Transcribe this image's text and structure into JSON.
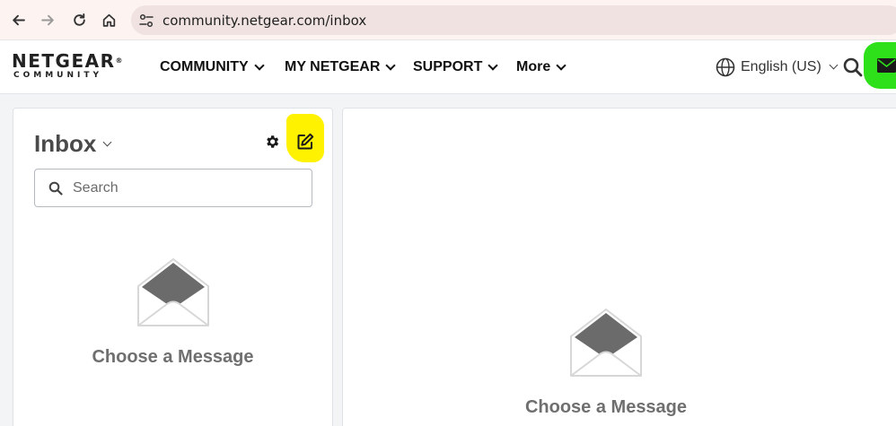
{
  "browser": {
    "url": "community.netgear.com/inbox"
  },
  "header": {
    "logo_main": "NETGEAR",
    "logo_mark": "®",
    "logo_sub": "COMMUNITY",
    "menu": [
      {
        "label": "COMMUNITY"
      },
      {
        "label": "MY NETGEAR"
      },
      {
        "label": "SUPPORT"
      },
      {
        "label": "More"
      }
    ],
    "language": "English (US)"
  },
  "inbox": {
    "title": "Inbox",
    "search_placeholder": "Search",
    "empty_text": "Choose a Message"
  },
  "detail": {
    "empty_text": "Choose a Message"
  },
  "colors": {
    "compose_highlight": "#fff200",
    "mail_highlight": "#2ee019",
    "envelope_flap": "#6b6b6b"
  },
  "icons": [
    "back-icon",
    "forward-icon",
    "reload-icon",
    "home-icon",
    "site-settings-icon",
    "globe-icon",
    "search-icon",
    "mail-icon",
    "gear-icon",
    "compose-icon",
    "envelope-open-icon"
  ]
}
